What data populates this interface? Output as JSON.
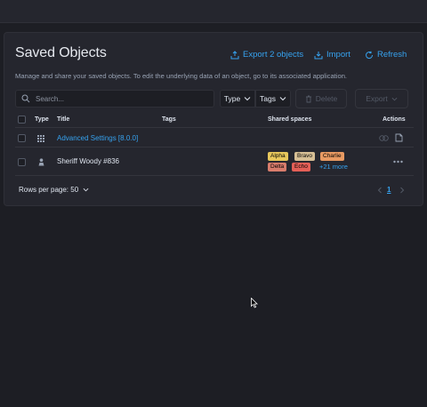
{
  "page": {
    "title": "Saved Objects",
    "description": "Manage and share your saved objects. To edit the underlying data of an object, go to its associated application."
  },
  "header_actions": {
    "export": "Export 2 objects",
    "import": "Import",
    "refresh": "Refresh"
  },
  "toolbar": {
    "search_placeholder": "Search...",
    "type_filter": "Type",
    "tags_filter": "Tags",
    "delete_label": "Delete",
    "export_label": "Export"
  },
  "table": {
    "columns": {
      "type": "Type",
      "title": "Title",
      "tags": "Tags",
      "shared": "Shared spaces",
      "actions": "Actions"
    },
    "rows": [
      {
        "type_icon": "grid-icon",
        "title": "Advanced Settings [8.0.0]",
        "title_is_link": true
      },
      {
        "type_icon": "user-icon",
        "title": "Sheriff Woody #836",
        "title_is_link": false,
        "spaces": [
          {
            "label": "Alpha",
            "color": "#e7c75c"
          },
          {
            "label": "Bravo",
            "color": "#d6bf95"
          },
          {
            "label": "Charlie",
            "color": "#e89a62"
          },
          {
            "label": "Delta",
            "color": "#d87c6c"
          },
          {
            "label": "Echo",
            "color": "#e35f57"
          }
        ],
        "more": "+21 more"
      }
    ]
  },
  "pagination": {
    "rows_per_page": "Rows per page: 50",
    "current_page": "1"
  },
  "colors": {
    "accent": "#36a2ef",
    "background": "#1d1e24",
    "panel": "#25262e"
  }
}
